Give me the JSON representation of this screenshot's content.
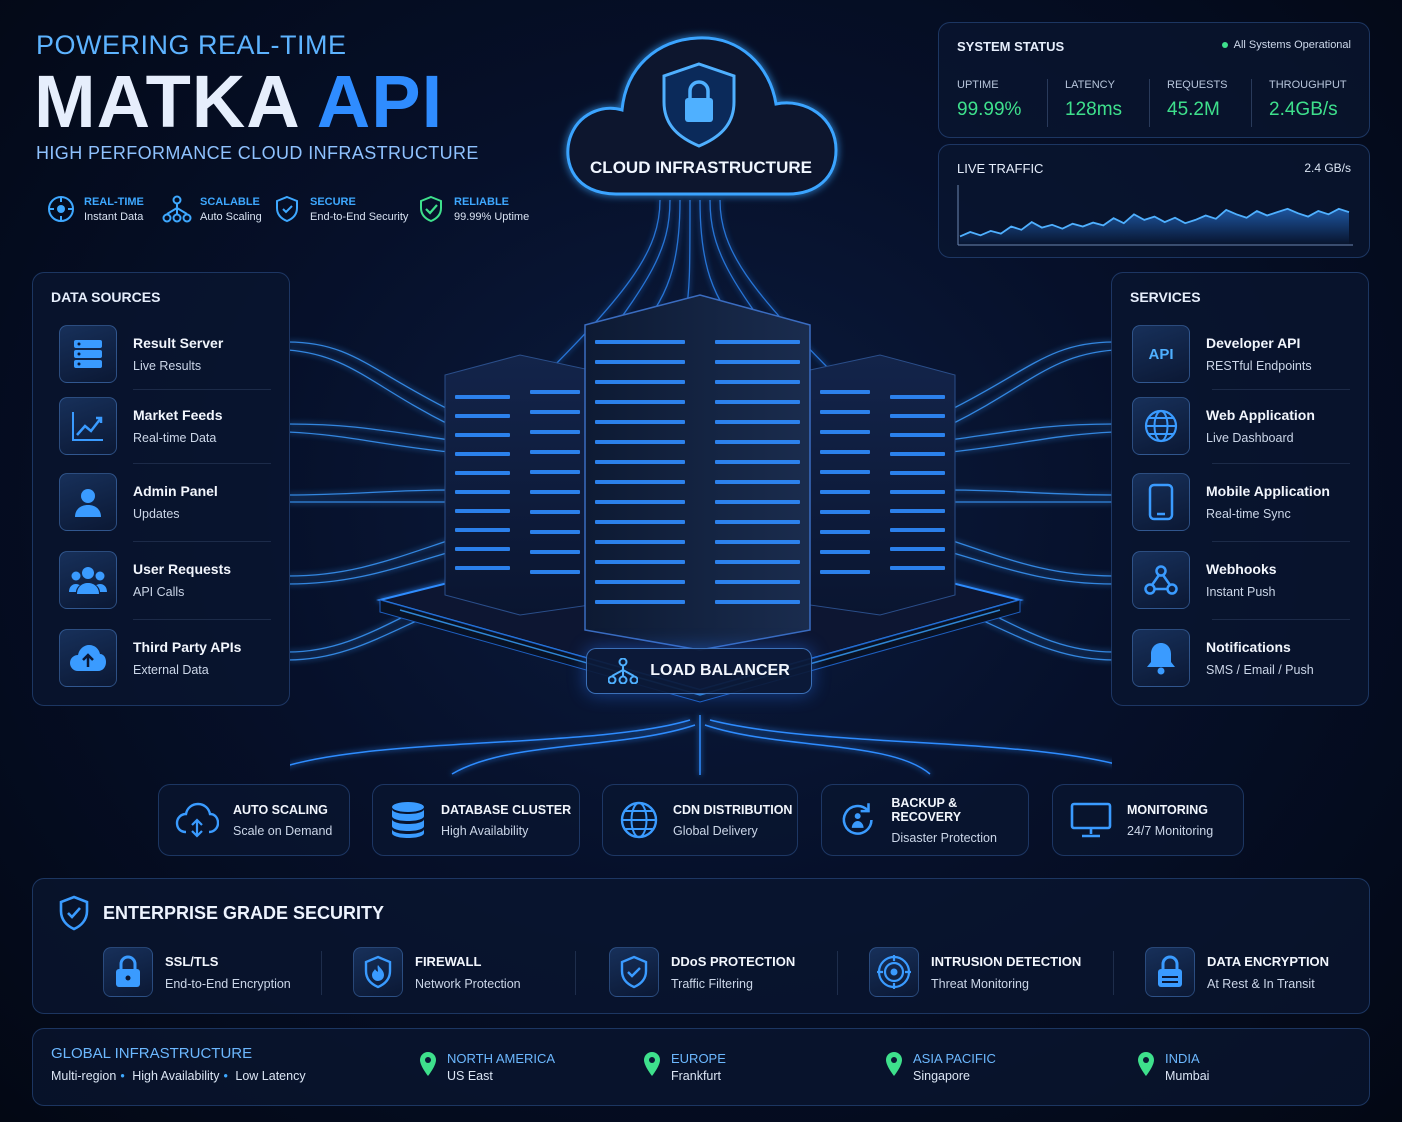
{
  "hero": {
    "kicker": "POWERING REAL-TIME",
    "title_main": "MATKA",
    "title_accent": "API",
    "subtitle": "HIGH PERFORMANCE CLOUD INFRASTRUCTURE",
    "features": [
      {
        "icon": "target-icon",
        "title": "REAL-TIME",
        "desc": "Instant Data"
      },
      {
        "icon": "network-icon",
        "title": "SCALABLE",
        "desc": "Auto Scaling"
      },
      {
        "icon": "shield-icon",
        "title": "SECURE",
        "desc": "End-to-End Security"
      },
      {
        "icon": "shield-check-icon",
        "title": "RELIABLE",
        "desc": "99.99% Uptime"
      }
    ]
  },
  "cloud": {
    "label": "CLOUD INFRASTRUCTURE",
    "icon": "lock-shield-icon"
  },
  "system_status": {
    "title": "SYSTEM STATUS",
    "operational": "All Systems Operational",
    "metrics": [
      {
        "label": "UPTIME",
        "value": "99.99%"
      },
      {
        "label": "LATENCY",
        "value": "128ms"
      },
      {
        "label": "REQUESTS",
        "value": "45.2M"
      },
      {
        "label": "THROUGHPUT",
        "value": "2.4GB/s"
      }
    ]
  },
  "live_traffic": {
    "title": "LIVE TRAFFIC",
    "value": "2.4 GB/s",
    "series": [
      0.12,
      0.2,
      0.14,
      0.22,
      0.17,
      0.3,
      0.24,
      0.38,
      0.28,
      0.33,
      0.26,
      0.35,
      0.3,
      0.37,
      0.32,
      0.45,
      0.36,
      0.52,
      0.42,
      0.48,
      0.38,
      0.46,
      0.36,
      0.42,
      0.5,
      0.44,
      0.6,
      0.52,
      0.46,
      0.58,
      0.5,
      0.56,
      0.62,
      0.54,
      0.48,
      0.58,
      0.52,
      0.62,
      0.56
    ]
  },
  "data_sources": {
    "title": "DATA SOURCES",
    "items": [
      {
        "icon": "server-icon",
        "title": "Result Server",
        "desc": "Live Results"
      },
      {
        "icon": "chart-line-icon",
        "title": "Market Feeds",
        "desc": "Real-time Data"
      },
      {
        "icon": "user-icon",
        "title": "Admin Panel",
        "desc": "Updates"
      },
      {
        "icon": "users-icon",
        "title": "User Requests",
        "desc": "API Calls"
      },
      {
        "icon": "cloud-upload-icon",
        "title": "Third Party APIs",
        "desc": "External Data"
      }
    ]
  },
  "services": {
    "title": "SERVICES",
    "items": [
      {
        "icon": "api-icon",
        "title": "Developer API",
        "desc": "RESTful Endpoints",
        "icon_text": "API"
      },
      {
        "icon": "globe-icon",
        "title": "Web Application",
        "desc": "Live Dashboard"
      },
      {
        "icon": "mobile-icon",
        "title": "Mobile Application",
        "desc": "Real-time Sync"
      },
      {
        "icon": "webhook-icon",
        "title": "Webhooks",
        "desc": "Instant Push"
      },
      {
        "icon": "bell-icon",
        "title": "Notifications",
        "desc": "SMS / Email / Push"
      }
    ]
  },
  "load_balancer": {
    "label": "LOAD BALANCER",
    "icon": "hierarchy-icon"
  },
  "infra": [
    {
      "icon": "cloud-scale-icon",
      "title": "AUTO SCALING",
      "desc": "Scale on Demand"
    },
    {
      "icon": "database-icon",
      "title": "DATABASE CLUSTER",
      "desc": "High Availability"
    },
    {
      "icon": "globe-icon",
      "title": "CDN DISTRIBUTION",
      "desc": "Global Delivery"
    },
    {
      "icon": "backup-icon",
      "title": "BACKUP & RECOVERY",
      "desc": "Disaster Protection"
    },
    {
      "icon": "monitor-icon",
      "title": "MONITORING",
      "desc": "24/7 Monitoring"
    }
  ],
  "security": {
    "title": "ENTERPRISE GRADE SECURITY",
    "items": [
      {
        "icon": "lock-icon",
        "title": "SSL/TLS",
        "desc": "End-to-End Encryption"
      },
      {
        "icon": "firewall-icon",
        "title": "FIREWALL",
        "desc": "Network Protection"
      },
      {
        "icon": "shield-icon",
        "title": "DDoS PROTECTION",
        "desc": "Traffic Filtering"
      },
      {
        "icon": "radar-icon",
        "title": "INTRUSION DETECTION",
        "desc": "Threat Monitoring"
      },
      {
        "icon": "encryption-icon",
        "title": "DATA ENCRYPTION",
        "desc": "At Rest & In Transit"
      }
    ]
  },
  "global": {
    "title": "GLOBAL INFRASTRUCTURE",
    "tags": [
      "Multi-region",
      "High Availability",
      "Low Latency"
    ],
    "regions": [
      {
        "name": "NORTH AMERICA",
        "city": "US East"
      },
      {
        "name": "EUROPE",
        "city": "Frankfurt"
      },
      {
        "name": "ASIA PACIFIC",
        "city": "Singapore"
      },
      {
        "name": "INDIA",
        "city": "Mumbai"
      }
    ]
  },
  "colors": {
    "accent": "#2f8cff",
    "green": "#3ee08c",
    "background": "#06102a"
  }
}
